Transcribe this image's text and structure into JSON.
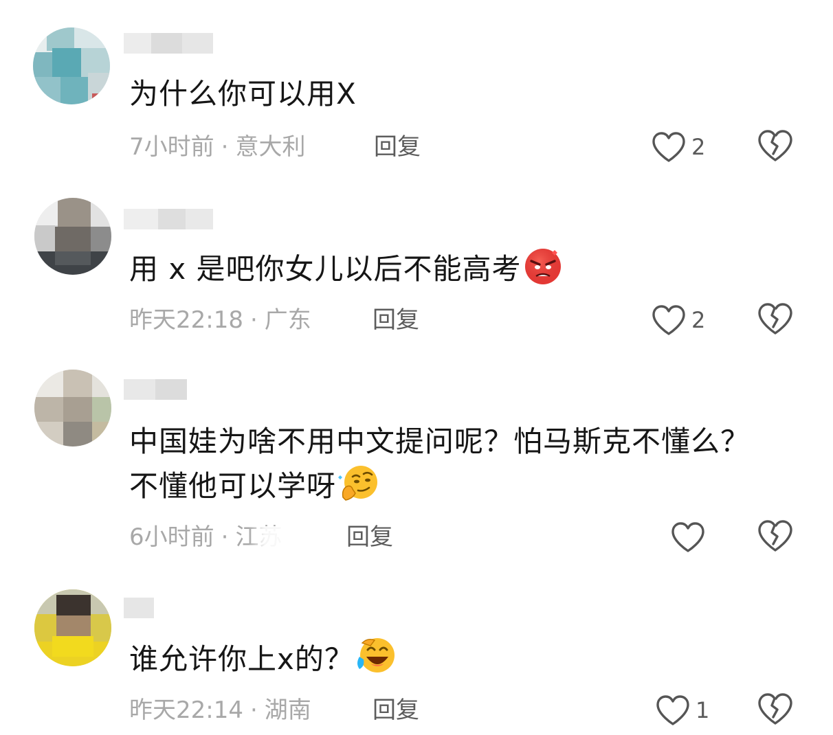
{
  "comments": [
    {
      "text": "为什么你可以用X",
      "time": "7小时前",
      "location": "意大利",
      "reply_label": "回复",
      "likes": "2",
      "emoji": null
    },
    {
      "text": "用 x 是吧你女儿以后不能高考",
      "time": "昨天22:18",
      "location": "广东",
      "reply_label": "回复",
      "likes": "2",
      "emoji": "angry-face-emoji"
    },
    {
      "text_line1": "中国娃为啥不用中文提问呢？怕马斯克不懂么？",
      "text_line2": "不懂他可以学呀",
      "time": "6小时前",
      "location": "江苏",
      "reply_label": "回复",
      "likes": "",
      "emoji": "thinking-smirk-emoji"
    },
    {
      "text": "谁允许你上x的？",
      "time": "昨天22:14",
      "location": "湖南",
      "reply_label": "回复",
      "likes": "1",
      "emoji": "laughing-crying-emoji"
    }
  ],
  "separator": "·",
  "colors": {
    "text": "#161616",
    "meta": "#a8a8a8",
    "reply": "#5c5c5c",
    "icon": "#555555"
  },
  "icons": {
    "like": "heart-outline-icon",
    "dislike": "broken-heart-icon"
  }
}
